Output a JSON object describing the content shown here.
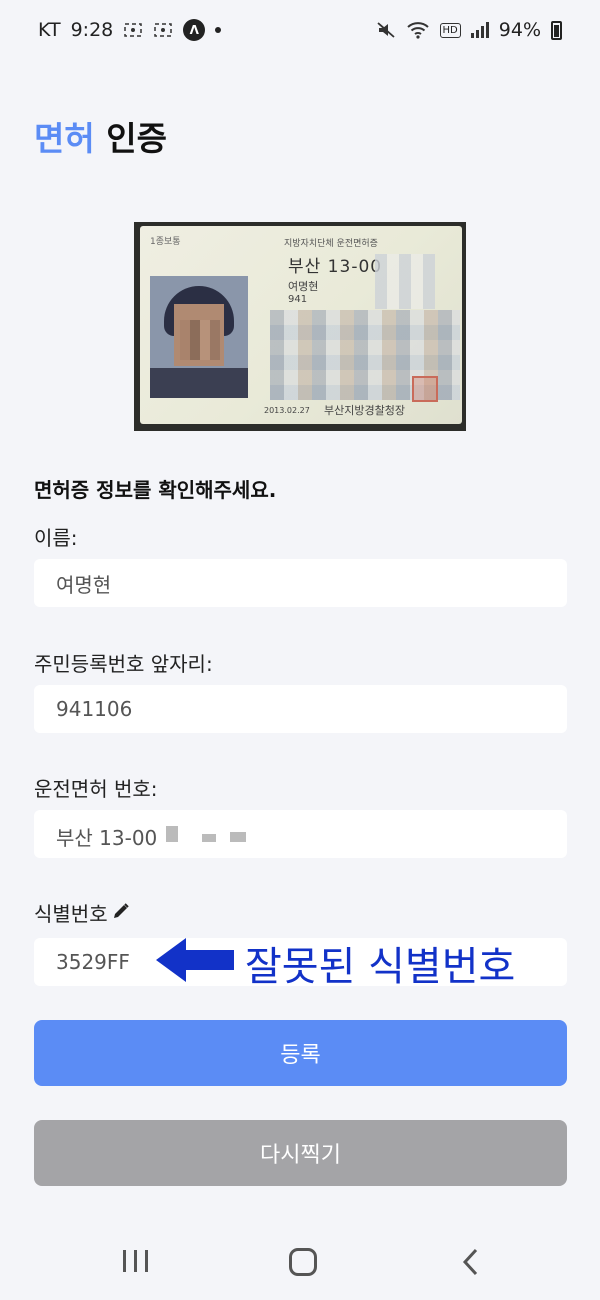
{
  "status_bar": {
    "carrier": "KT",
    "time": "9:28",
    "battery": "94%",
    "hd": "HD"
  },
  "header": {
    "title_accent": "면허",
    "title_rest": "인증"
  },
  "license_card": {
    "type": "1종보통",
    "header": "지방자치단체 운전면허증",
    "region_number": "부산 13-00",
    "name": "여명현",
    "id_prefix": "941",
    "issue_date": "2013.02.27",
    "issuer": "부산지방경찰청장"
  },
  "form": {
    "heading": "면허증 정보를 확인해주세요.",
    "name_label": "이름:",
    "name_value": "여명현",
    "rrn_label": "주민등록번호 앞자리:",
    "rrn_value": "941106",
    "license_label": "운전면허 번호:",
    "license_value": "부산 13-00",
    "serial_label": "식별번호",
    "serial_value": "3529FF"
  },
  "annotation": {
    "text": "잘못된 식별번호",
    "color": "#1232c8"
  },
  "buttons": {
    "register": "등록",
    "retake": "다시찍기"
  },
  "colors": {
    "accent": "#5b8cf5",
    "secondary_button": "#a4a4a7",
    "background": "#f4f5f9"
  }
}
